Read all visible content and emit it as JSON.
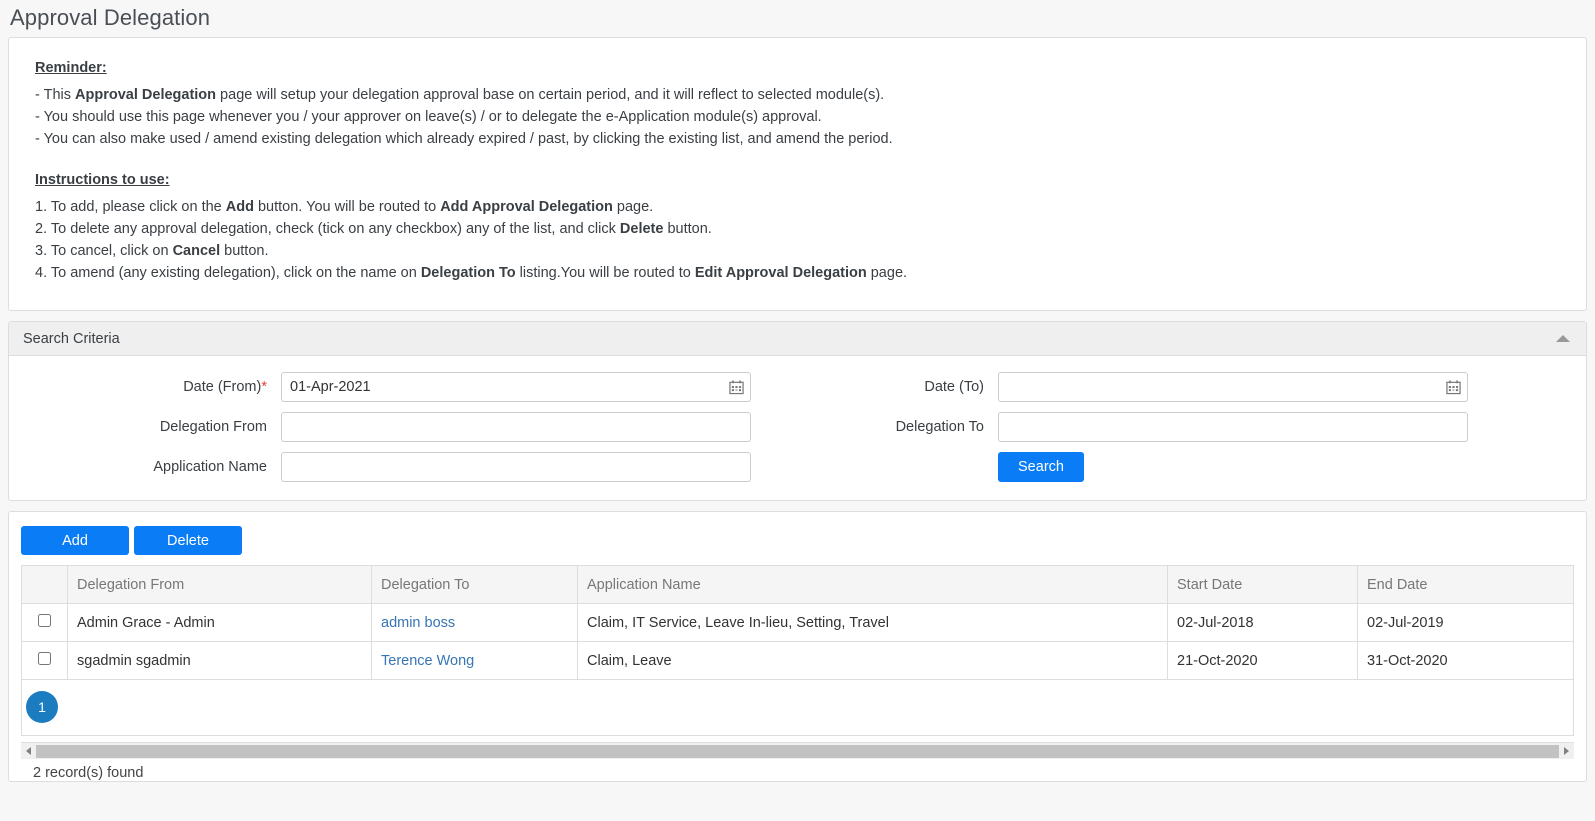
{
  "page": {
    "title": "Approval Delegation"
  },
  "info": {
    "reminder_heading": "Reminder:",
    "reminder_lines": [
      {
        "prefix": "- This ",
        "bold": "Approval Delegation",
        "suffix": " page will setup your delegation approval base on certain period, and it will reflect to selected module(s)."
      },
      {
        "prefix": "- You should use this page whenever you / your approver on leave(s) / or to delegate the e-Application module(s) approval.",
        "bold": "",
        "suffix": ""
      },
      {
        "prefix": "- You can also make used / amend existing delegation which already expired / past, by clicking the existing list, and amend the period.",
        "bold": "",
        "suffix": ""
      }
    ],
    "instructions_heading": "Instructions to use:",
    "instruction_lines": [
      {
        "a": "1. To add, please click on the ",
        "b1": "Add",
        "c": " button. You will be routed to ",
        "b2": "Add Approval Delegation",
        "d": " page."
      },
      {
        "a": "2. To delete any approval delegation, check (tick on any checkbox) any of the list, and click ",
        "b1": "Delete",
        "c": " button.",
        "b2": "",
        "d": ""
      },
      {
        "a": "3. To cancel, click on ",
        "b1": "Cancel",
        "c": " button.",
        "b2": "",
        "d": ""
      },
      {
        "a": "4. To amend (any existing delegation), click on the name on ",
        "b1": "Delegation To",
        "c": " listing.You will be routed to ",
        "b2": "Edit Approval Delegation",
        "d": " page."
      }
    ]
  },
  "search": {
    "panel_title": "Search Criteria",
    "collapse_icon": "caret-up-icon",
    "date_from_label": "Date (From)",
    "date_from_required": "*",
    "date_from_value": "01-Apr-2021",
    "date_from_placeholder": "",
    "date_to_label": "Date (To)",
    "date_to_value": "",
    "date_to_placeholder": "",
    "delegation_from_label": "Delegation From",
    "delegation_from_value": "",
    "delegation_from_placeholder": "",
    "delegation_to_label": "Delegation To",
    "delegation_to_value": "",
    "delegation_to_placeholder": "",
    "application_name_label": "Application Name",
    "application_name_value": "",
    "application_name_placeholder": "",
    "search_button": "Search",
    "calendar_icon": "calendar-icon"
  },
  "list": {
    "add_button": "Add",
    "delete_button": "Delete",
    "columns": [
      "",
      "Delegation From",
      "Delegation To",
      "Application Name",
      "Start Date",
      "End Date"
    ],
    "rows": [
      {
        "checked": false,
        "delegation_from": "Admin Grace - Admin",
        "delegation_to": "admin boss",
        "application_name": "Claim, IT Service, Leave In-lieu, Setting, Travel",
        "start_date": "02-Jul-2018",
        "end_date": "02-Jul-2019"
      },
      {
        "checked": false,
        "delegation_from": "sgadmin sgadmin",
        "delegation_to": "Terence Wong",
        "application_name": "Claim, Leave",
        "start_date": "21-Oct-2020",
        "end_date": "31-Oct-2020"
      }
    ],
    "current_page": "1",
    "record_count_text": "2 record(s) found",
    "scroll_left_icon": "arrow-left-icon",
    "scroll_right_icon": "arrow-right-icon"
  },
  "colors": {
    "primary_button": "#0a7cf5",
    "link": "#3775b5",
    "pager_badge": "#1b7cc0",
    "required_asterisk": "#e2413c"
  }
}
